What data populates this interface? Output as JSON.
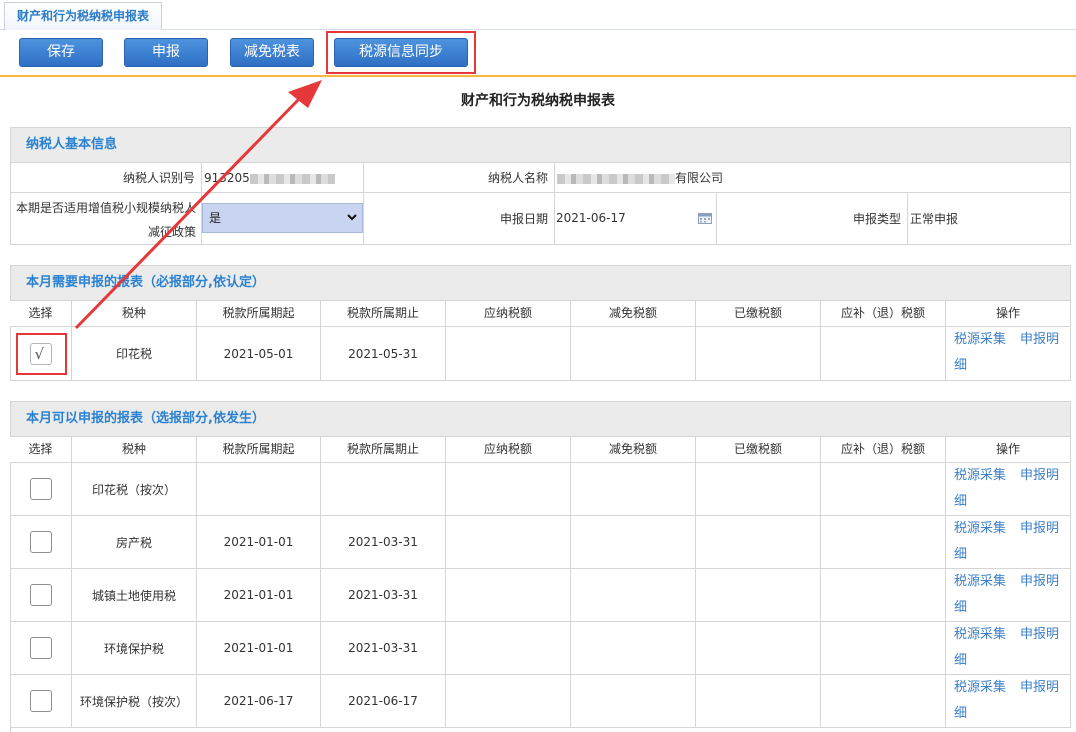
{
  "tab": {
    "label": "财产和行为税纳税申报表"
  },
  "toolbar": {
    "save": "保存",
    "declare": "申报",
    "relief": "减免税表",
    "sync": "税源信息同步"
  },
  "page_title": "财产和行为税纳税申报表",
  "taxpayer": {
    "section_title": "纳税人基本信息",
    "id_label": "纳税人识别号",
    "id_value_prefix": "913205",
    "name_label": "纳税人名称",
    "name_value_suffix": "有限公司",
    "policy_label": "本期是否适用增值税小规模纳税人减征政策",
    "policy_value": "是",
    "date_label": "申报日期",
    "date_value": "2021-06-17",
    "type_label": "申报类型",
    "type_value": "正常申报"
  },
  "columns": [
    "选择",
    "税种",
    "税款所属期起",
    "税款所属期止",
    "应纳税额",
    "减免税额",
    "已缴税额",
    "应补（退）税额",
    "操作"
  ],
  "ops": {
    "collect": "税源采集",
    "detail": "申报明细"
  },
  "required": {
    "section_title": "本月需要申报的报表（必报部分,依认定）",
    "rows": [
      {
        "tax": "印花税",
        "start": "2021-05-01",
        "end": "2021-05-31",
        "checked": true
      }
    ]
  },
  "optional": {
    "section_title": "本月可以申报的报表（选报部分,依发生）",
    "rows": [
      {
        "tax": "印花税（按次）",
        "start": "",
        "end": "",
        "checked": false
      },
      {
        "tax": "房产税",
        "start": "2021-01-01",
        "end": "2021-03-31",
        "checked": false
      },
      {
        "tax": "城镇土地使用税",
        "start": "2021-01-01",
        "end": "2021-03-31",
        "checked": false
      },
      {
        "tax": "环境保护税",
        "start": "2021-01-01",
        "end": "2021-03-31",
        "checked": false
      },
      {
        "tax": "环境保护税（按次）",
        "start": "2021-06-17",
        "end": "2021-06-17",
        "checked": false
      }
    ]
  },
  "colors": {
    "accent": "#2a82d2",
    "button": "#3a7fd0",
    "highlight": "#e5383b",
    "toolbar_line": "#f6b93b"
  }
}
